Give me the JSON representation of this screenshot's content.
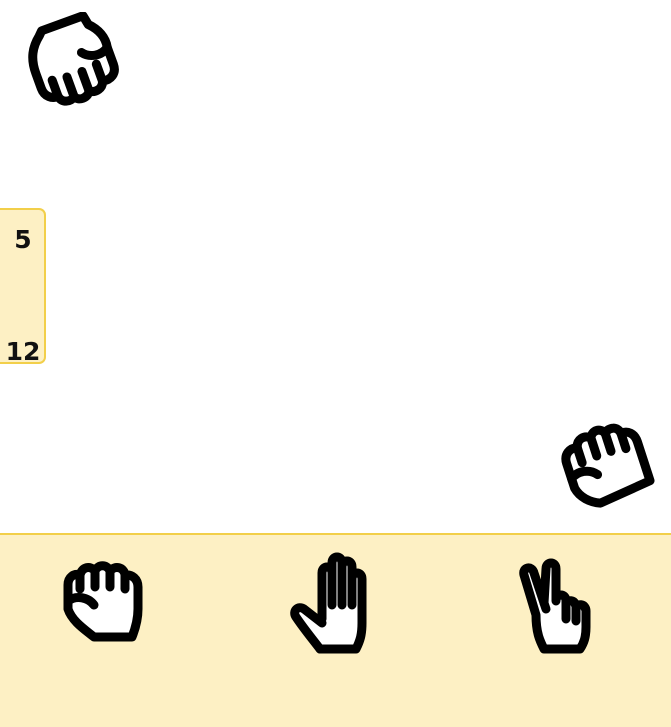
{
  "game": {
    "opponent_hand": {
      "icon": "rock-fist-icon"
    },
    "player_hand": {
      "icon": "rock-fist-icon"
    },
    "score": {
      "top": "5",
      "bottom": "12"
    },
    "choices": [
      {
        "id": "rock",
        "icon": "rock-hand-icon"
      },
      {
        "id": "paper",
        "icon": "paper-hand-icon"
      },
      {
        "id": "scissors",
        "icon": "scissors-hand-icon"
      }
    ],
    "colors": {
      "panel_fill": "#fdf0c4",
      "panel_border": "#f2cf4a",
      "stroke": "#000000"
    }
  }
}
